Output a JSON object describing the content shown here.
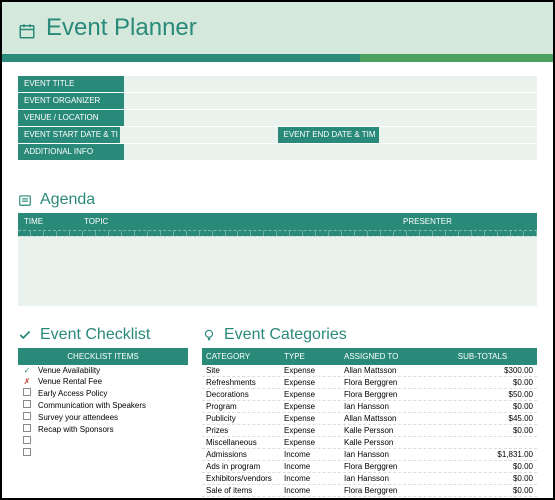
{
  "header": {
    "title": "Event Planner"
  },
  "info": {
    "labels": {
      "title": "EVENT TITLE",
      "organizer": "EVENT ORGANIZER",
      "venue": "VENUE / LOCATION",
      "start": "EVENT START DATE & TI",
      "end": "EVENT END DATE & TIM",
      "additional": "ADDITIONAL INFO"
    }
  },
  "agenda": {
    "title": "Agenda",
    "headers": {
      "time": "TIME",
      "topic": "TOPIC",
      "presenter": "PRESENTER"
    }
  },
  "checklist": {
    "title": "Event Checklist",
    "header": "CHECKLIST ITEMS",
    "items": [
      {
        "status": "ok",
        "label": "Venue Availability"
      },
      {
        "status": "no",
        "label": "Venue Rental Fee"
      },
      {
        "status": "box",
        "label": "Early Access Policy"
      },
      {
        "status": "box",
        "label": "Communication with Speakers"
      },
      {
        "status": "box",
        "label": "Survey your attendees"
      },
      {
        "status": "box",
        "label": "Recap with Sponsors"
      },
      {
        "status": "box",
        "label": ""
      },
      {
        "status": "box",
        "label": ""
      }
    ]
  },
  "categories": {
    "title": "Event Categories",
    "headers": {
      "category": "CATEGORY",
      "type": "TYPE",
      "assigned": "ASSIGNED TO",
      "subtotals": "SUB-TOTALS"
    },
    "rows": [
      {
        "category": "Site",
        "type": "Expense",
        "assigned": "Allan Mattsson",
        "subtotal": "$300.00"
      },
      {
        "category": "Refreshments",
        "type": "Expense",
        "assigned": "Flora Berggren",
        "subtotal": "$0.00"
      },
      {
        "category": "Decorations",
        "type": "Expense",
        "assigned": "Flora Berggren",
        "subtotal": "$50.00"
      },
      {
        "category": "Program",
        "type": "Expense",
        "assigned": "Ian Hansson",
        "subtotal": "$0.00"
      },
      {
        "category": "Publicity",
        "type": "Expense",
        "assigned": "Allan Mattsson",
        "subtotal": "$45.00"
      },
      {
        "category": "Prizes",
        "type": "Expense",
        "assigned": "Kalle Persson",
        "subtotal": "$0.00"
      },
      {
        "category": "Miscellaneous",
        "type": "Expense",
        "assigned": "Kalle Persson",
        "subtotal": ""
      },
      {
        "category": "Admissions",
        "type": "Income",
        "assigned": "Ian Hansson",
        "subtotal": "$1,831.00"
      },
      {
        "category": "Ads in program",
        "type": "Income",
        "assigned": "Flora Berggren",
        "subtotal": "$0.00"
      },
      {
        "category": "Exhibitors/vendors",
        "type": "Income",
        "assigned": "Ian Hansson",
        "subtotal": "$0.00"
      },
      {
        "category": "Sale of items",
        "type": "Income",
        "assigned": "Flora Berggren",
        "subtotal": "$0.00"
      }
    ]
  }
}
